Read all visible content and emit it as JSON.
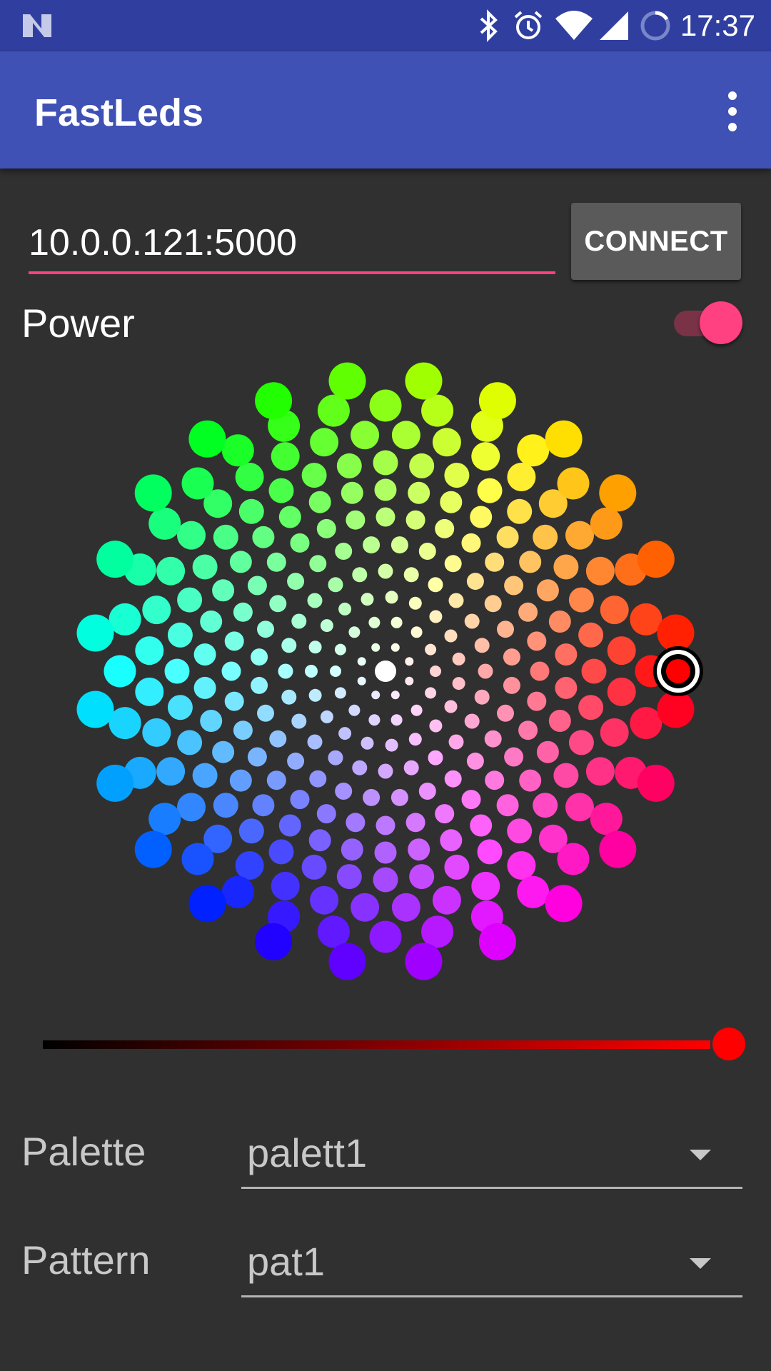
{
  "status_bar": {
    "time": "17:37",
    "icons": [
      "n-logo-icon",
      "bluetooth-icon",
      "alarm-icon",
      "wifi-icon",
      "cell-signal-icon",
      "battery-ring-icon"
    ]
  },
  "app_bar": {
    "title": "FastLeds",
    "menu_icon": "more-vert-icon"
  },
  "connection": {
    "address": "10.0.0.121:5000",
    "connect_label": "CONNECT",
    "accent": "#ff4081"
  },
  "power": {
    "label": "Power",
    "on": true
  },
  "color_picker": {
    "selected_color": "#ff0000",
    "selected_hue_deg": 0,
    "selected_saturation": 1.0
  },
  "brightness": {
    "value": 1.0,
    "gradient_end": "#ff0000"
  },
  "palette": {
    "label": "Palette",
    "selected": "palett1"
  },
  "pattern": {
    "label": "Pattern",
    "selected": "pat1"
  },
  "colors": {
    "status_bar": "#303f9f",
    "app_bar": "#3f51b5",
    "background": "#303030",
    "button": "#5a5a5a"
  }
}
